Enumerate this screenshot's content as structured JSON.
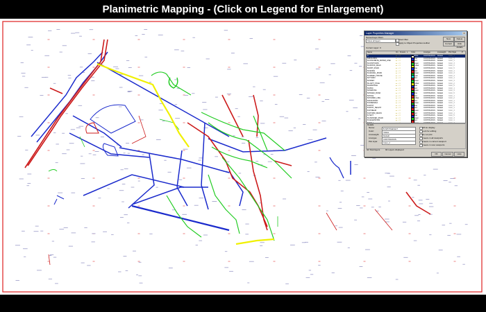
{
  "page": {
    "title": "Planimetric Mapping - (Click on Legend for Enlargement)"
  },
  "colors": {
    "background": "#000000",
    "map_background": "#ffffff",
    "border_red": "#e03030",
    "road_blue": "#1a2acc",
    "river_red": "#cc1a1a",
    "contour_green": "#22cc22",
    "highlight_yellow": "#f0f000",
    "dialog_grey": "#d4d0c8",
    "dialog_titlebar": "#0a246a"
  },
  "dialog": {
    "title": "Layer Properties Manager",
    "named_filters_label": "Named layer filters",
    "filter_value": "Show all layers",
    "invert_label": "Invert filter",
    "apply_label": "Apply to Object Properties toolbar",
    "new_button": "New",
    "delete_button": "Delete",
    "current_button": "Current",
    "show_details_button": "Hide details",
    "current_layer": "Current Layer: 0",
    "columns": [
      "Name",
      "On",
      "Freeze",
      "L",
      "Color",
      "Linetype",
      "Lineweight",
      "Plot Style",
      "P"
    ],
    "layers": [
      {
        "name": "0",
        "color": "#ffffff",
        "color_name": "White",
        "linetype": "CONTINUOUS",
        "lineweight": "Default",
        "plot": "Color_7"
      },
      {
        "name": "B-BUILDING",
        "color": "#1a2acc",
        "color_name": "Blue",
        "linetype": "CONTINUOUS",
        "lineweight": "Default",
        "plot": "Color_5"
      },
      {
        "name": "B-CONCRETE_WATER_LINE",
        "color": "#cc1a1a",
        "color_name": "Red",
        "linetype": "CONTINUOUS",
        "lineweight": "Default",
        "plot": "Color_1"
      },
      {
        "name": "B-CONTOURS",
        "color": "#22cc22",
        "color_name": "Green",
        "linetype": "CONTINUOUS",
        "lineweight": "Default",
        "plot": "Color_3"
      },
      {
        "name": "B-CROSS_WALK",
        "color": "#f0f000",
        "color_name": "Yellow",
        "linetype": "CONTINUOUS",
        "lineweight": "Default",
        "plot": "Color_2"
      },
      {
        "name": "B-DIRT_ROAD",
        "color": "#1a2acc",
        "color_name": "Blue",
        "linetype": "CONTINUOUS",
        "lineweight": "Default",
        "plot": "Color_5"
      },
      {
        "name": "B-FENCE",
        "color": "#cc1a1a",
        "color_name": "Red",
        "linetype": "CONTINUOUS",
        "lineweight": "Default",
        "plot": "Color_1"
      },
      {
        "name": "B-GRAVEL_ROAD",
        "color": "#22cc22",
        "color_name": "Green",
        "linetype": "CONTINUOUS",
        "lineweight": "Default",
        "plot": "Color_3"
      },
      {
        "name": "B-GREEN_HOUSE",
        "color": "#00cccc",
        "color_name": "Cyan",
        "linetype": "CONTINUOUS",
        "lineweight": "Default",
        "plot": "Color_4"
      },
      {
        "name": "B-HYDRO",
        "color": "#cc1a1a",
        "color_name": "Red",
        "linetype": "CONTINUOUS",
        "lineweight": "Default",
        "plot": "Color_1"
      },
      {
        "name": "B-INDEX",
        "color": "#22cc22",
        "color_name": "Green",
        "linetype": "CONTINUOUS",
        "lineweight": "Default",
        "plot": "Color_3"
      },
      {
        "name": "B-LIGHT_POLE",
        "color": "#f0f000",
        "color_name": "Yellow",
        "linetype": "CONTINUOUS",
        "lineweight": "Default",
        "plot": "Color_2"
      },
      {
        "name": "B-MANHOLE",
        "color": "#1a2acc",
        "color_name": "Blue",
        "linetype": "CONTINUOUS",
        "lineweight": "Default",
        "plot": "Color_5"
      },
      {
        "name": "B-MISC",
        "color": "#cc1a1a",
        "color_name": "Red",
        "linetype": "CONTINUOUS",
        "lineweight": "Default",
        "plot": "Color_1"
      },
      {
        "name": "B-PARKING",
        "color": "#22cc22",
        "color_name": "Green",
        "linetype": "CONTINUOUS",
        "lineweight": "Default",
        "plot": "Color_3"
      },
      {
        "name": "B-PAVED_ROAD",
        "color": "#1a2acc",
        "color_name": "Blue",
        "linetype": "CONTINUOUS",
        "lineweight": "Default",
        "plot": "Color_5"
      },
      {
        "name": "B-POLE",
        "color": "#cc1a1a",
        "color_name": "Red",
        "linetype": "CONTINUOUS",
        "lineweight": "Default",
        "plot": "Color_1"
      },
      {
        "name": "B-POWER_LINE",
        "color": "#f0f000",
        "color_name": "Yellow",
        "linetype": "CONTINUOUS",
        "lineweight": "Default",
        "plot": "Color_2"
      },
      {
        "name": "B-RAILROAD",
        "color": "#cc1a1a",
        "color_name": "Red",
        "linetype": "CONTINUOUS",
        "lineweight": "Default",
        "plot": "Color_1"
      },
      {
        "name": "B-SIDEWALK",
        "color": "#22cc22",
        "color_name": "Green",
        "linetype": "CONTINUOUS",
        "lineweight": "Default",
        "plot": "Color_3"
      },
      {
        "name": "B-SPOT",
        "color": "#1a2acc",
        "color_name": "Blue",
        "linetype": "CONTINUOUS",
        "lineweight": "Default",
        "plot": "Color_5"
      },
      {
        "name": "B-SPOT_HEIGHT",
        "color": "#cc1a1a",
        "color_name": "Red",
        "linetype": "CONTINUOUS",
        "lineweight": "Default",
        "plot": "Color_1"
      },
      {
        "name": "B-STREAM",
        "color": "#22cc22",
        "color_name": "Green",
        "linetype": "CONTINUOUS",
        "lineweight": "Default",
        "plot": "Color_3"
      },
      {
        "name": "B-STORM_DRAIN",
        "color": "#cc1a1a",
        "color_name": "Red",
        "linetype": "CONTINUOUS",
        "lineweight": "Default",
        "plot": "Color_1"
      },
      {
        "name": "B-TEXT",
        "color": "#1a2acc",
        "color_name": "Blue",
        "linetype": "CONTINUOUS",
        "lineweight": "Default",
        "plot": "Color_5"
      },
      {
        "name": "B-UNPAVED_ROAD",
        "color": "#22cc22",
        "color_name": "Green",
        "linetype": "CONTINUOUS",
        "lineweight": "Default",
        "plot": "Color_3"
      },
      {
        "name": "B-VEGETATION",
        "color": "#cc1a1a",
        "color_name": "Red",
        "linetype": "CONTINUOUS",
        "lineweight": "Default",
        "plot": "Color_1"
      },
      {
        "name": "B-WALL",
        "color": "#22cc22",
        "color_name": "Green",
        "linetype": "CONTINUOUS",
        "lineweight": "Default",
        "plot": "Color_3"
      }
    ],
    "details": {
      "title": "Details",
      "name_label": "Name:",
      "name_value": "B-SPOTHEIGHT",
      "color_label": "Color:",
      "color_value": "Yellow",
      "lineweight_label": "Lineweight:",
      "lineweight_value": "Default",
      "linetype_label": "Linetype:",
      "linetype_value": "CONTINUOUS",
      "plot_style_label": "Plot style:",
      "plot_style_value": "Color_2",
      "options": [
        "Off for display",
        "Lock for editing",
        "Do not plot",
        "Freeze in all viewports",
        "Freeze in current viewport",
        "Freeze in new viewports"
      ],
      "footer_total": "94 Total layers",
      "footer_displayed": "94 Layers displayed"
    },
    "ok_button": "OK",
    "cancel_button": "Cancel",
    "help_button": "Help"
  }
}
